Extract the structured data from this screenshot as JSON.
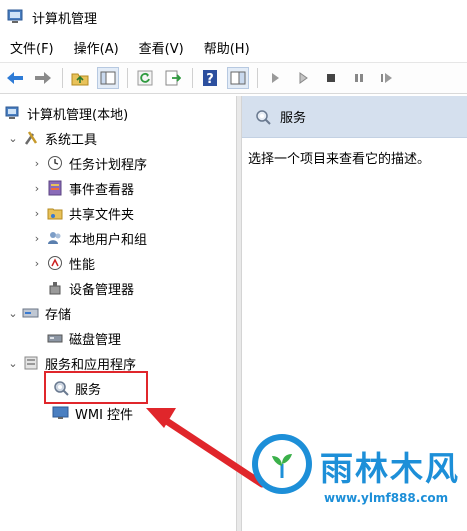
{
  "window": {
    "title": "计算机管理"
  },
  "menu": [
    "文件(F)",
    "操作(A)",
    "查看(V)",
    "帮助(H)"
  ],
  "toolbar": {
    "buttons": [
      "back-icon",
      "forward-icon",
      "up-folder-icon",
      "show-tree-icon",
      "refresh-icon",
      "export-icon",
      "help-icon",
      "properties-icon",
      "play-icon",
      "play-outline-icon",
      "stop-icon",
      "pause-icon",
      "restart-icon"
    ]
  },
  "tree": {
    "root": "计算机管理(本地)",
    "system_tools": "系统工具",
    "task_scheduler": "任务计划程序",
    "event_viewer": "事件查看器",
    "shared_folders": "共享文件夹",
    "local_users": "本地用户和组",
    "performance": "性能",
    "device_manager": "设备管理器",
    "storage": "存储",
    "disk_management": "磁盘管理",
    "services_apps": "服务和应用程序",
    "services": "服务",
    "wmi": "WMI 控件"
  },
  "right_pane": {
    "header": "服务",
    "description": "选择一个项目来查看它的描述。"
  },
  "watermark": {
    "name": "雨林木风",
    "url": "www.ylmf888.com"
  },
  "colors": {
    "highlight": "#e0262b",
    "header_bg": "#d5e0ee",
    "watermark": "#1d8fd8"
  }
}
